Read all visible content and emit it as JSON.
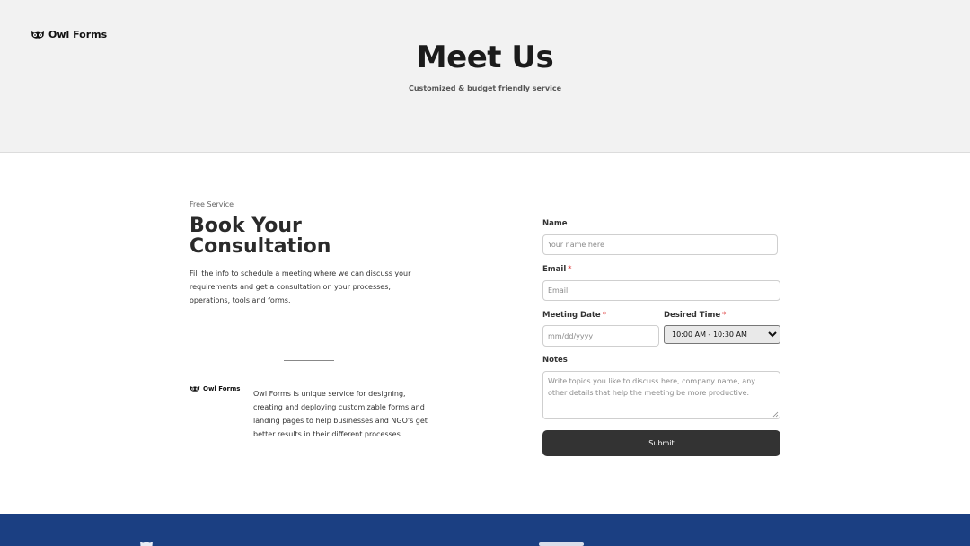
{
  "header": {
    "logo_text": "Owl Forms",
    "title": "Meet Us",
    "subtitle": "Customized & budget friendly service"
  },
  "intro": {
    "eyebrow": "Free Service",
    "title_line1": "Book Your",
    "title_line2": "Consultation",
    "description": "Fill the info to schedule a meeting where we can discuss your requirements and get a consultation on your processes, operations, tools and forms."
  },
  "about": {
    "logo_text": "Owl Forms",
    "text": "Owl Forms is unique service for designing, creating and deploying customizable forms and landing pages to help businesses and NGO's get better results in their different processes."
  },
  "form": {
    "name": {
      "label": "Name",
      "placeholder": "Your name here",
      "value": ""
    },
    "email": {
      "label": "Email",
      "required_mark": "*",
      "placeholder": "Email",
      "value": ""
    },
    "meeting_date": {
      "label": "Meeting Date",
      "required_mark": "*",
      "placeholder": "mm/dd/yyyy",
      "value": ""
    },
    "desired_time": {
      "label": "Desired Time",
      "required_mark": "*",
      "selected": "10:00 AM - 10:30 AM"
    },
    "notes": {
      "label": "Notes",
      "placeholder": "Write topics you like to discuss here, company name, any other details that help the meeting be more productive.",
      "value": ""
    },
    "submit_label": "Submit"
  },
  "colors": {
    "hero_bg": "#f2f2f2",
    "button_bg": "#333333",
    "footer_bg": "#1b3f82",
    "required": "#dd3333"
  },
  "icons": {
    "logo": "owl-icon"
  }
}
